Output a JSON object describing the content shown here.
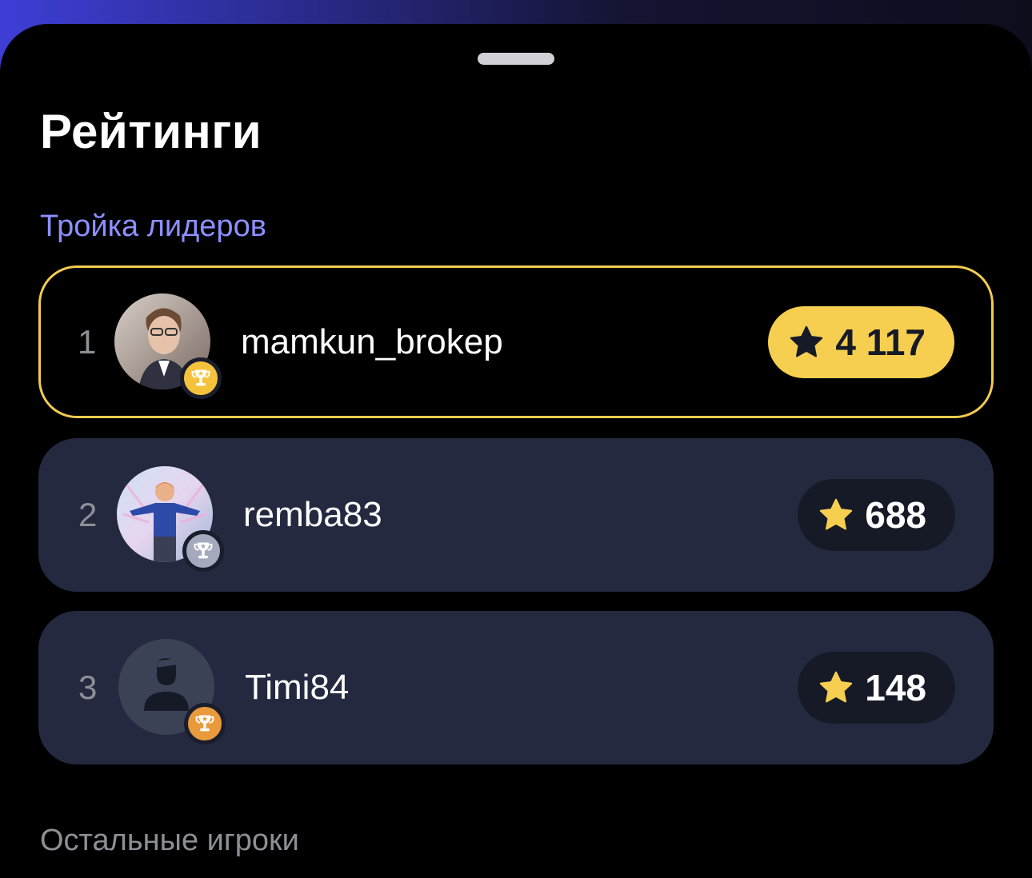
{
  "sheet": {
    "title": "Рейтинги",
    "top_section_label": "Тройка лидеров",
    "rest_section_label": "Остальные игроки"
  },
  "leaders": [
    {
      "rank": "1",
      "username": "mamkun_brokep",
      "score": "4 117",
      "avatar": "user-photo-avatar",
      "trophy": "gold-trophy-icon",
      "trophy_color": "#f5c33b",
      "highlight_color": "#f3cb4f"
    },
    {
      "rank": "2",
      "username": "remba83",
      "score": "688",
      "avatar": "user-photo-avatar",
      "trophy": "silver-trophy-icon",
      "trophy_color": "#a4a9bd"
    },
    {
      "rank": "3",
      "username": "Timi84",
      "score": "148",
      "avatar": "default-user-avatar",
      "trophy": "bronze-trophy-icon",
      "trophy_color": "#e89a3c"
    }
  ],
  "colors": {
    "accent_gold": "#f6cf50",
    "card_background": "#242940",
    "section_label_accent": "#8c90ff",
    "star": "#f6cf50"
  }
}
